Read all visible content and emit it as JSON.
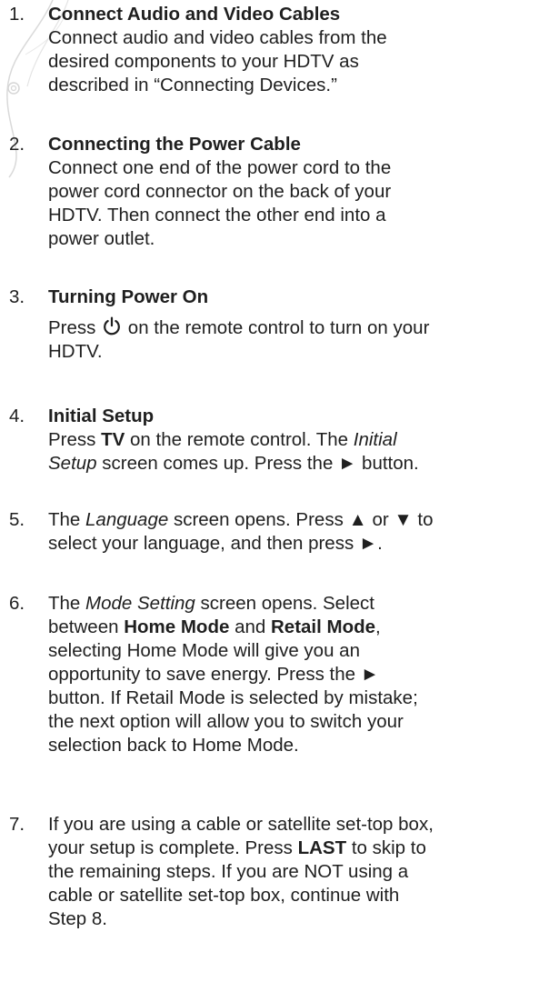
{
  "steps": [
    {
      "number": "1.",
      "title": "Connect Audio and Video Cables",
      "lines": [
        "Connect audio and video cables from the",
        "desired components to your HDTV as",
        "described in “Connecting Devices.”"
      ]
    },
    {
      "number": "2.",
      "title": "Connecting the Power Cable",
      "lines": [
        "Connect one end of the power cord to the",
        "power cord connector on the back of your",
        "HDTV. Then connect the other end into a",
        "power outlet."
      ]
    },
    {
      "number": "3.",
      "title": "Turning Power On",
      "line1_pre": "Press ",
      "line1_post": " on the remote control to turn on your",
      "line2": "HDTV."
    },
    {
      "number": "4.",
      "title": "Initial Setup",
      "l1_a": "Press ",
      "l1_b": "TV",
      "l1_c": " on the remote control. The ",
      "l1_d": "Initial",
      "l2_a": "Setup",
      "l2_b": " screen comes up. Press the ► button."
    },
    {
      "number": "5.",
      "l1_a": "The ",
      "l1_b": "Language",
      "l1_c": " screen opens. Press ▲ or ▼ to",
      "l2": "select your language, and then press ►."
    },
    {
      "number": "6.",
      "l1_a": "The ",
      "l1_b": "Mode Setting",
      "l1_c": " screen opens. Select",
      "l2_a": "between ",
      "l2_b": "Home Mode",
      "l2_c": " and ",
      "l2_d": "Retail Mode",
      "l2_e": ",",
      "lines": [
        "selecting Home Mode will give you an",
        "opportunity to save energy. Press the ►",
        "button. If Retail Mode is selected by mistake;",
        "the next option will allow you to switch your",
        "selection back to Home Mode."
      ]
    },
    {
      "number": "7.",
      "l1": "If you are using a cable or satellite set-top box,",
      "l2_a": "your setup is complete. Press ",
      "l2_b": "LAST",
      "l2_c": " to skip to",
      "lines": [
        "the remaining steps. If you are NOT using a",
        "cable or satellite set-top box, continue with",
        "Step 8."
      ]
    }
  ]
}
